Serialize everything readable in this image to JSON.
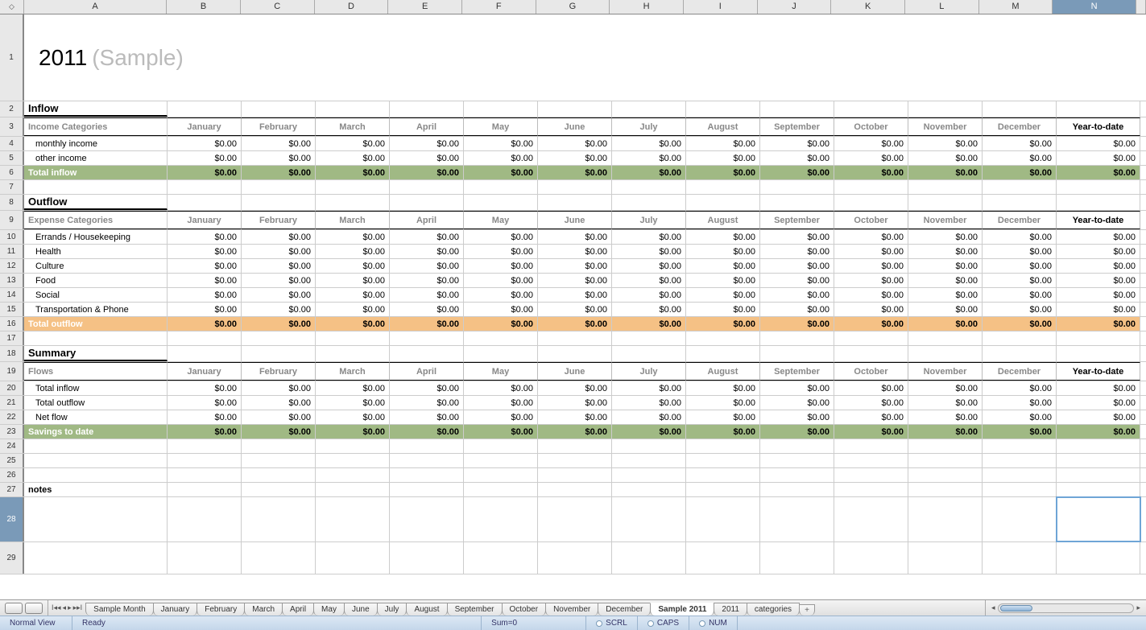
{
  "title_year": "2011",
  "title_sample": "(Sample)",
  "columns": [
    "A",
    "B",
    "C",
    "D",
    "E",
    "F",
    "G",
    "H",
    "I",
    "J",
    "K",
    "L",
    "M",
    "N"
  ],
  "months": [
    "January",
    "February",
    "March",
    "April",
    "May",
    "June",
    "July",
    "August",
    "September",
    "October",
    "November",
    "December"
  ],
  "ytd_label": "Year-to-date",
  "zero": "$0.00",
  "inflow": {
    "section": "Inflow",
    "cat_header": "Income Categories",
    "rows": [
      "monthly income",
      "other income"
    ],
    "total_label": "Total inflow"
  },
  "outflow": {
    "section": "Outflow",
    "cat_header": "Expense Categories",
    "rows": [
      "Errands / Housekeeping",
      "Health",
      "Culture",
      "Food",
      "Social",
      "Transportation & Phone"
    ],
    "total_label": "Total outflow"
  },
  "summary": {
    "section": "Summary",
    "cat_header": "Flows",
    "rows": [
      "Total inflow",
      "Total outflow",
      "Net flow"
    ],
    "total_label": "Savings to date"
  },
  "notes_label": "notes",
  "tabs": [
    "Sample Month",
    "January",
    "February",
    "March",
    "April",
    "May",
    "June",
    "July",
    "August",
    "September",
    "October",
    "November",
    "December",
    "Sample 2011",
    "2011",
    "categories"
  ],
  "active_tab": "Sample 2011",
  "status": {
    "view": "Normal View",
    "ready": "Ready",
    "sum": "Sum=0",
    "scrl": "SCRL",
    "caps": "CAPS",
    "num": "NUM"
  },
  "selected_col": "N",
  "row_numbers": [
    1,
    2,
    3,
    4,
    5,
    6,
    7,
    8,
    9,
    10,
    11,
    12,
    13,
    14,
    15,
    16,
    17,
    18,
    19,
    20,
    21,
    22,
    23,
    24,
    25,
    26,
    27,
    28,
    29
  ],
  "row_header_corner": "◇"
}
